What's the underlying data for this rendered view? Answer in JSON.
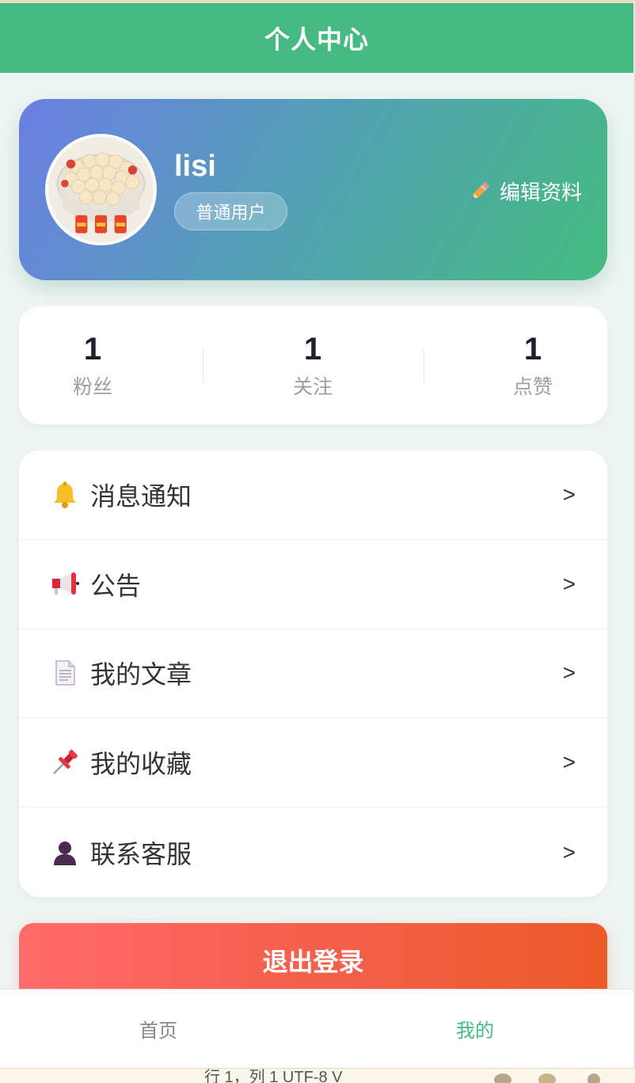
{
  "header": {
    "title": "个人中心"
  },
  "profile": {
    "username": "lisi",
    "role": "普通用户",
    "edit_label": "编辑资料"
  },
  "stats": [
    {
      "value": "1",
      "label": "粉丝"
    },
    {
      "value": "1",
      "label": "关注"
    },
    {
      "value": "1",
      "label": "点赞"
    }
  ],
  "menu": {
    "arrow": ">",
    "items": [
      {
        "label": "消息通知",
        "icon": "bell-icon"
      },
      {
        "label": "公告",
        "icon": "megaphone-icon"
      },
      {
        "label": "我的文章",
        "icon": "document-icon"
      },
      {
        "label": "我的收藏",
        "icon": "pushpin-icon"
      },
      {
        "label": "联系客服",
        "icon": "person-icon"
      }
    ]
  },
  "logout_label": "退出登录",
  "tabbar": {
    "items": [
      {
        "label": "首页",
        "active": false
      },
      {
        "label": "我的",
        "active": true
      }
    ]
  },
  "statusbar": {
    "text": "行 1，列 1    UTF-8    V"
  },
  "colors": {
    "brand": "#46ba82",
    "logout": "#f25e45"
  }
}
